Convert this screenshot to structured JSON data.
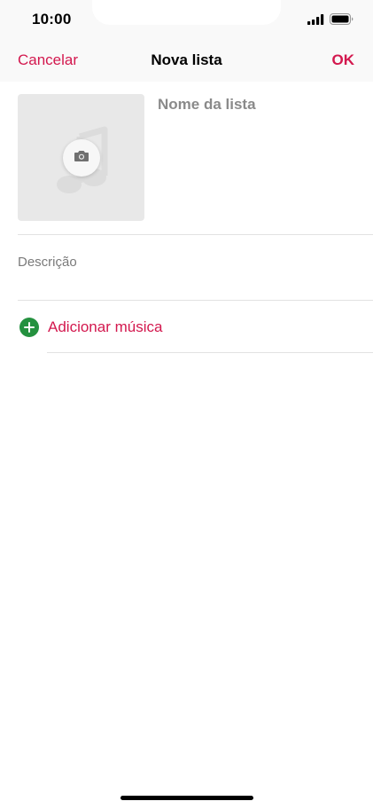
{
  "status_bar": {
    "time": "10:00",
    "icons": [
      "signal-icon",
      "battery-icon"
    ]
  },
  "nav": {
    "cancel_label": "Cancelar",
    "title": "Nova lista",
    "ok_label": "OK"
  },
  "artwork": {
    "icons": [
      "music-note-icon",
      "camera-icon"
    ]
  },
  "form": {
    "name_placeholder": "Nome da lista",
    "name_value": "",
    "description_placeholder": "Descrição",
    "description_value": ""
  },
  "add_music": {
    "label": "Adicionar música",
    "icon": "plus-circle-icon"
  },
  "colors": {
    "accent": "#d3184e",
    "add_green": "#24913f",
    "artwork_bg": "#e8e8e8",
    "bar_bg": "#f9f9f9",
    "divider": "#e2e2e2"
  }
}
